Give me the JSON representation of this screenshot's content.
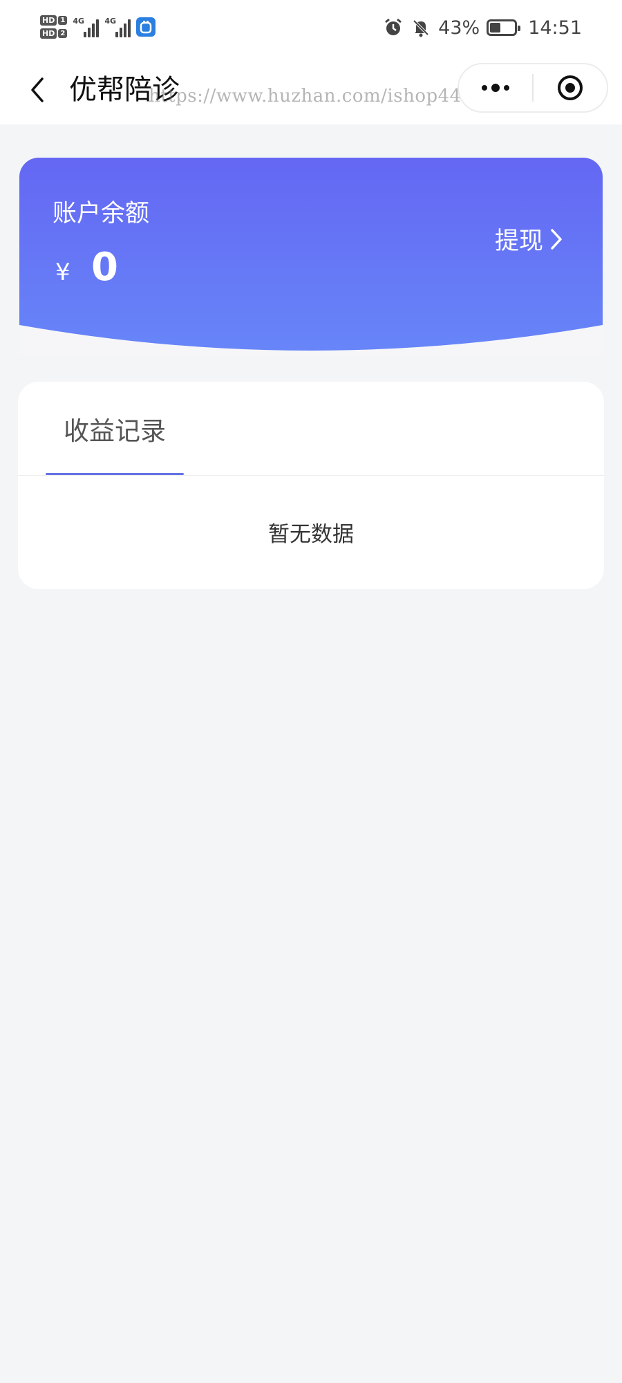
{
  "status_bar": {
    "sim1_label": "HD",
    "sim1_index": "1",
    "sim2_label": "HD",
    "sim2_index": "2",
    "network1": "4G",
    "network2": "4G",
    "battery_percent": "43%",
    "battery_level": 0.43,
    "time": "14:51",
    "icons": [
      "alarm-icon",
      "bell-muted-icon",
      "battery-icon",
      "app-notification-icon"
    ]
  },
  "nav": {
    "title": "优帮陪诊",
    "watermark": "https://www.huzhan.com/ishop44453",
    "back_icon": "chevron-left-icon",
    "more_icon": "more-dots-icon",
    "close_icon": "target-circle-icon"
  },
  "balance": {
    "label": "账户余额",
    "currency": "¥",
    "amount": "0",
    "withdraw_label": "提现",
    "gradient": [
      "#6467f3",
      "#6786f8"
    ]
  },
  "records": {
    "tab_label": "收益记录",
    "empty_text": "暂无数据",
    "accent": "#6574e6"
  }
}
